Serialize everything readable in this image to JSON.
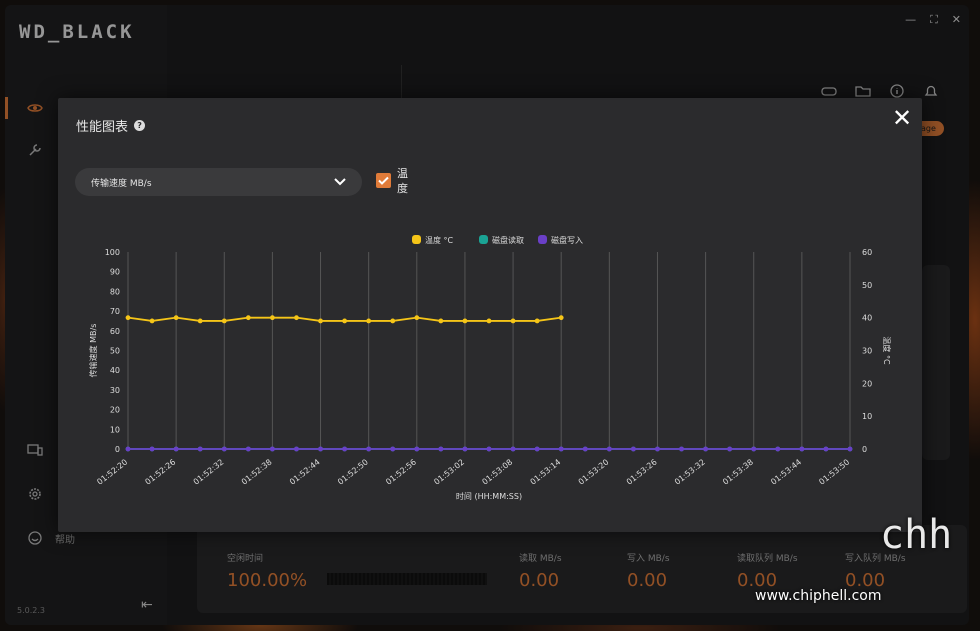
{
  "app": {
    "logo": "WD_BLACK",
    "version": "5.0.2.3"
  },
  "window_controls": {
    "minimize": "—",
    "maximize": "⛶",
    "close": "✕"
  },
  "sidebar": {
    "items": [
      {
        "icon": "eye-icon",
        "label": ""
      },
      {
        "icon": "wrench-icon",
        "label": ""
      },
      {
        "icon": "devices-icon",
        "label": ""
      },
      {
        "icon": "gear-icon",
        "label": ""
      },
      {
        "icon": "help-circle-icon",
        "label": "帮助"
      }
    ]
  },
  "badge": {
    "text": "age"
  },
  "stats": {
    "idle_time_label": "空闲时间",
    "idle_time_value": "100.00%",
    "read_label": "读取 MB/s",
    "read_value": "0.00",
    "write_label": "写入 MB/s",
    "write_value": "0.00",
    "read_queue_label": "读取队列 MB/s",
    "read_queue_value": "0.00",
    "write_queue_label": "写入队列 MB/s",
    "write_queue_value": "0.00"
  },
  "modal": {
    "title": "性能图表",
    "close": "✕",
    "select_value": "传输速度 MB/s",
    "checkbox_label": "温度",
    "checkbox_checked": true
  },
  "watermark": "www.chiphell.com",
  "colors": {
    "accent": "#e07b39",
    "temperature": "#f5c518",
    "disk_read": "#1aa394",
    "disk_write": "#6a3fc7"
  },
  "chart_data": {
    "type": "line",
    "x": [
      "01:52:20",
      "01:52:23",
      "01:52:26",
      "01:52:29",
      "01:52:32",
      "01:52:35",
      "01:52:38",
      "01:52:41",
      "01:52:44",
      "01:52:47",
      "01:52:50",
      "01:52:53",
      "01:52:56",
      "01:52:59",
      "01:53:02",
      "01:53:05",
      "01:53:08",
      "01:53:11",
      "01:53:14",
      "01:53:17",
      "01:53:20",
      "01:53:23",
      "01:53:26",
      "01:53:29",
      "01:53:32",
      "01:53:35",
      "01:53:38",
      "01:53:41",
      "01:53:44",
      "01:53:47",
      "01:53:50"
    ],
    "x_ticks": [
      "01:52:20",
      "01:52:26",
      "01:52:32",
      "01:52:38",
      "01:52:44",
      "01:52:50",
      "01:52:56",
      "01:53:02",
      "01:53:08",
      "01:53:14",
      "01:53:20",
      "01:53:26",
      "01:53:32",
      "01:53:38",
      "01:53:44",
      "01:53:50"
    ],
    "series": [
      {
        "name": "温度 °C",
        "axis": "right",
        "values": [
          40,
          39,
          40,
          39,
          39,
          40,
          40,
          40,
          39,
          39,
          39,
          39,
          40,
          39,
          39,
          39,
          39,
          39,
          40
        ]
      },
      {
        "name": "磁盘读取",
        "axis": "left",
        "values": [
          0,
          0,
          0,
          0,
          0,
          0,
          0,
          0,
          0,
          0,
          0,
          0,
          0,
          0,
          0,
          0,
          0,
          0,
          0,
          0,
          0,
          0,
          0,
          0,
          0,
          0,
          0,
          0,
          0,
          0,
          0
        ]
      },
      {
        "name": "磁盘写入",
        "axis": "left",
        "values": [
          0,
          0,
          0,
          0,
          0,
          0,
          0,
          0,
          0,
          0,
          0,
          0,
          0,
          0,
          0,
          0,
          0,
          0,
          0,
          0,
          0,
          0,
          0,
          0,
          0,
          0,
          0,
          0,
          0,
          0,
          0
        ]
      }
    ],
    "xlabel": "时间 (HH:MM:SS)",
    "ylabel": "传输速度 MB/s",
    "y2label": "温度 °C",
    "ylim": [
      0,
      100
    ],
    "y_ticks": [
      0,
      10,
      20,
      30,
      40,
      50,
      60,
      70,
      80,
      90,
      100
    ],
    "y2lim": [
      0,
      60
    ],
    "y2_ticks": [
      0,
      10,
      20,
      30,
      40,
      50,
      60
    ],
    "legend": "top-center",
    "grid": "vertical"
  }
}
